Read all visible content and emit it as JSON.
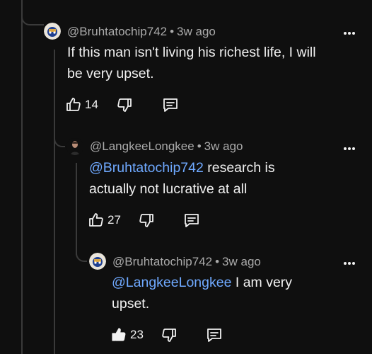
{
  "comments": [
    {
      "author": "@Bruhtatochip742",
      "time": "3w ago",
      "text": "If this man isn't living his richest life, I will be very upset.",
      "likes": "14"
    },
    {
      "author": "@LangkeeLongkee",
      "time": "3w ago",
      "mention": "@Bruhtatochip742",
      "text_after_mention": " research is actually not lucrative at all",
      "likes": "27"
    },
    {
      "author": "@Bruhtatochip742",
      "time": "3w ago",
      "mention": "@LangkeeLongkee",
      "text_after_mention": " I am very upset.",
      "likes": "23"
    }
  ],
  "separator": "•",
  "icons": {
    "like": "thumbs-up-icon",
    "like_filled": "thumbs-up-filled-icon",
    "dislike": "thumbs-down-icon",
    "reply": "reply-icon",
    "more": "more-vertical-icon"
  },
  "colors": {
    "background": "#0f0f0f",
    "text": "#f1f1f1",
    "meta": "#aaaaaa",
    "mention": "#6fa9ff",
    "thread_line": "#3a3a3a"
  }
}
